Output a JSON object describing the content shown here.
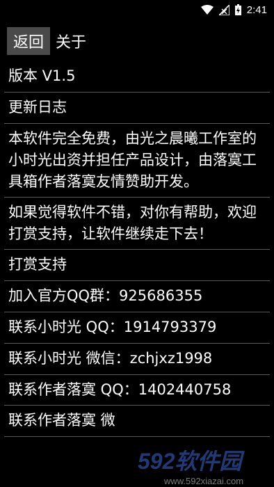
{
  "status_bar": {
    "time": "2:41",
    "icons": [
      "wifi-icon",
      "signal-icon",
      "battery-charging-icon"
    ]
  },
  "toolbar": {
    "back_label": "返回",
    "title": "关于"
  },
  "items": [
    {
      "label": "版本 V1.5"
    },
    {
      "label": "更新日志"
    },
    {
      "label": "本软件完全免费，由光之晨曦工作室的小时光出资并担任产品设计，由落寞工具箱作者落寞友情赞助开发。"
    },
    {
      "label": "如果觉得软件不错，对你有帮助，欢迎打赏支持，让软件继续走下去！"
    },
    {
      "label": "打赏支持"
    },
    {
      "label": "加入官方QQ群：925686355"
    },
    {
      "label": "联系小时光 QQ：1914793379"
    },
    {
      "label": "联系小时光 微信：zchjxz1998"
    },
    {
      "label": "联系作者落寞 QQ：1402440758"
    },
    {
      "label": "联系作者落寞 微"
    }
  ],
  "watermark": {
    "main": "592软件园",
    "sub": "www.592xiazai.com"
  },
  "colors": {
    "background": "#000000",
    "button_bg": "#4a4a4a",
    "divider": "#5a5a5a",
    "watermark_blue": "#3d6ad8"
  }
}
